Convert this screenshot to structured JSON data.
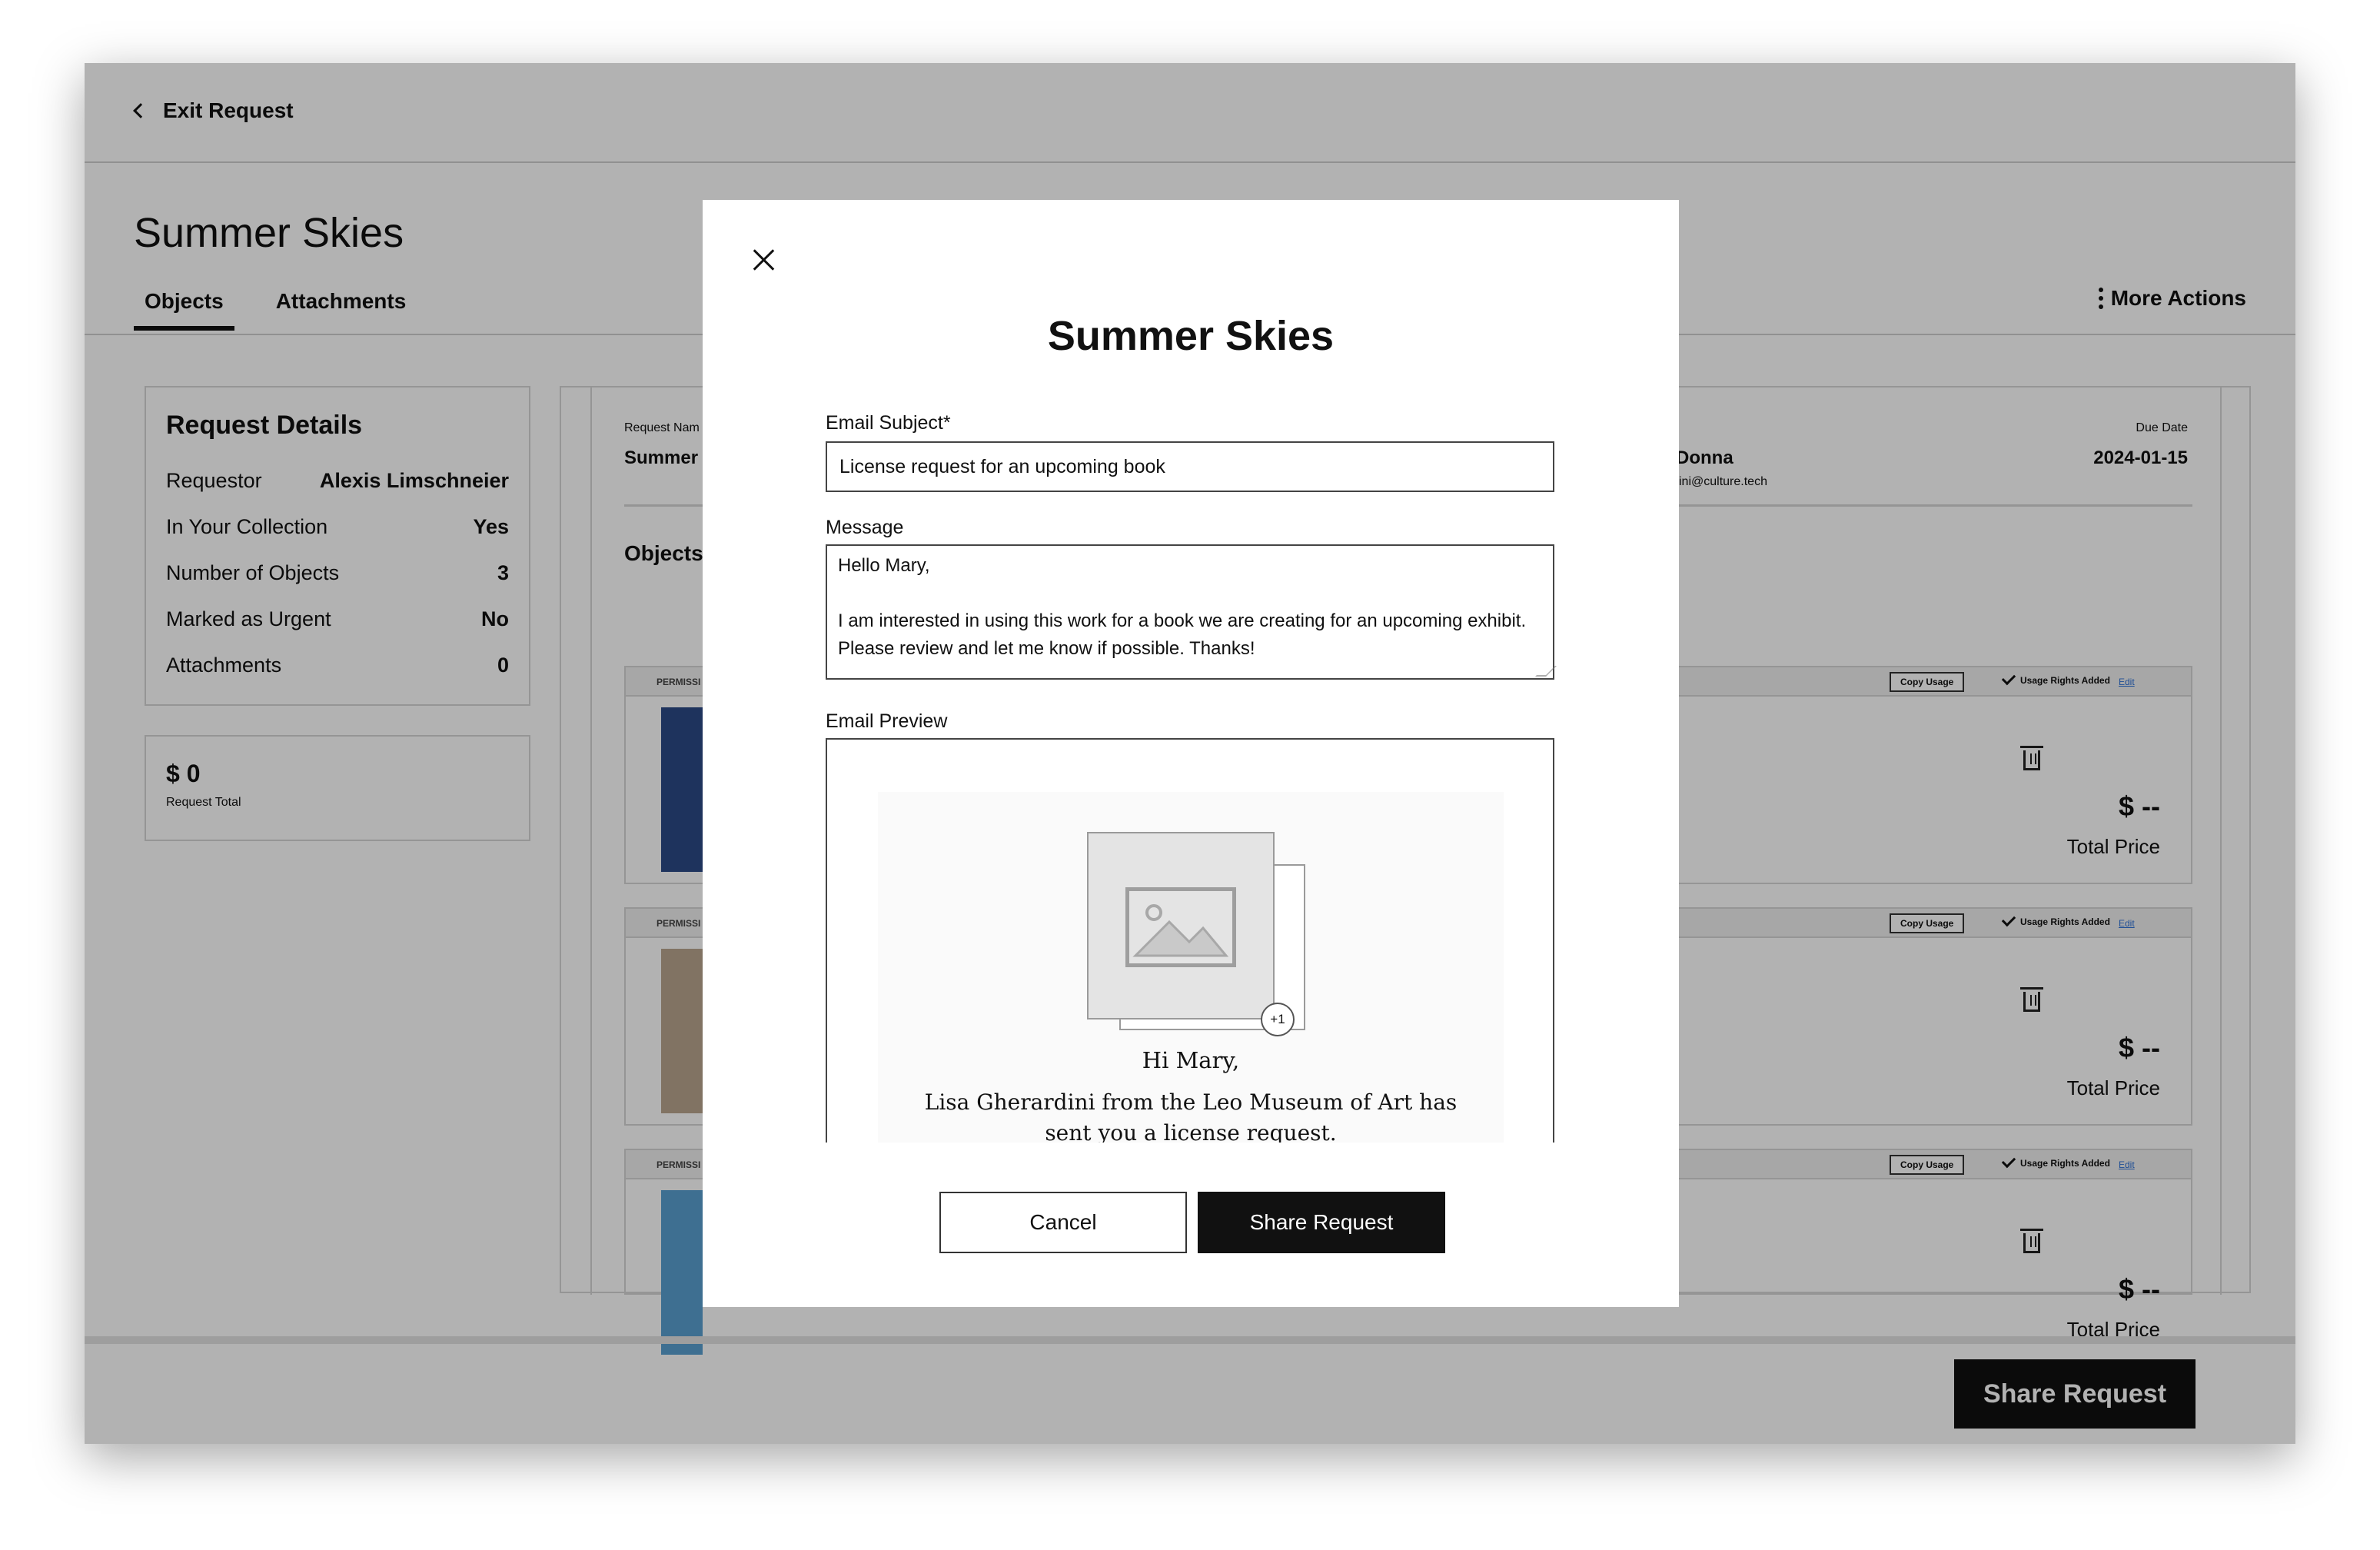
{
  "header": {
    "exit_label": "Exit Request"
  },
  "page": {
    "title": "Summer Skies",
    "tabs": [
      {
        "label": "Objects"
      },
      {
        "label": "Attachments"
      }
    ],
    "more_actions_label": "More Actions"
  },
  "request_details": {
    "heading": "Request Details",
    "rows": [
      {
        "label": "Requestor",
        "value": "Alexis Limschneier"
      },
      {
        "label": "In Your Collection",
        "value": "Yes"
      },
      {
        "label": "Number of Objects",
        "value": "3"
      },
      {
        "label": "Marked as Urgent",
        "value": "No"
      },
      {
        "label": "Attachments",
        "value": "0"
      }
    ]
  },
  "request_total": {
    "amount": "$ 0",
    "label": "Request Total"
  },
  "request_meta": {
    "name_label": "Request Nam",
    "name_value": "Summer",
    "assignee_name": "a Donna",
    "assignee_email": ".vicini@culture.tech",
    "due_label": "Due Date",
    "due_value": "2024-01-15"
  },
  "objects_section": {
    "heading": "Objects",
    "permission_label": "PERMISSI",
    "copy_usage_label": "Copy Usage",
    "usage_added_label": "Usage Rights Added",
    "edit_label": "Edit",
    "price_value": "$ --",
    "price_label": "Total Price",
    "thumbnail_colors": [
      "#2c4a86",
      "#b9a58e",
      "#5a9fd0"
    ]
  },
  "footer": {
    "share_label": "Share Request"
  },
  "modal": {
    "title": "Summer Skies",
    "subject_label": "Email Subject*",
    "subject_value": "License request for an upcoming book",
    "message_label": "Message",
    "message_value": "Hello Mary,\n\nI am interested in using this work for a book we are creating for an upcoming exhibit. Please review and let me know if possible. Thanks!",
    "preview_label": "Email Preview",
    "preview": {
      "badge": "+1",
      "greeting": "Hi Mary,",
      "body": "Lisa Gherardini from the Leo Museum of Art has sent you a license request."
    },
    "cancel_label": "Cancel",
    "share_label": "Share Request"
  }
}
